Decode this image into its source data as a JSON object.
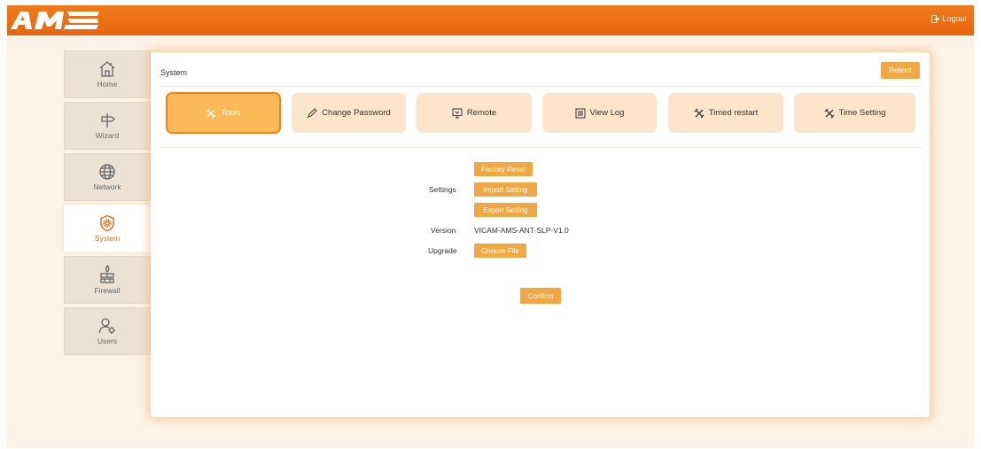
{
  "header": {
    "logo_text": "AMS",
    "logout_label": "Logout"
  },
  "sidebar": {
    "items": [
      {
        "label": "Home",
        "icon": "home-icon"
      },
      {
        "label": "Wizard",
        "icon": "signpost-icon"
      },
      {
        "label": "Network",
        "icon": "globe-icon"
      },
      {
        "label": "System",
        "icon": "shield-gear-icon",
        "active": true
      },
      {
        "label": "Firewall",
        "icon": "firewall-icon"
      },
      {
        "label": "Users",
        "icon": "users-icon"
      }
    ]
  },
  "panel": {
    "title": "System",
    "reboot_label": "Reboot"
  },
  "tabs": [
    {
      "label": "Tools",
      "icon": "tools-icon",
      "active": true
    },
    {
      "label": "Change Password",
      "icon": "pen-icon"
    },
    {
      "label": "Remote",
      "icon": "monitor-icon"
    },
    {
      "label": "View Log",
      "icon": "log-icon"
    },
    {
      "label": "Timed restart",
      "icon": "tools-icon"
    },
    {
      "label": "Time Setting",
      "icon": "tools-icon"
    }
  ],
  "tools": {
    "settings_label": "Settings",
    "factory_reset": "Factory Reset",
    "import_setting": "Import Setting",
    "export_setting": "Export Setting",
    "version_label": "Version",
    "version_value": "VICAM-AMS-ANT-SLP-V1.0",
    "upgrade_label": "Upgrade",
    "choose_file": "Choose File",
    "confirm": "Confirm"
  },
  "colors": {
    "brand": "#e8650f",
    "button": "#f0a843",
    "tab": "#fde5cc",
    "tab_active": "#fdb957"
  }
}
